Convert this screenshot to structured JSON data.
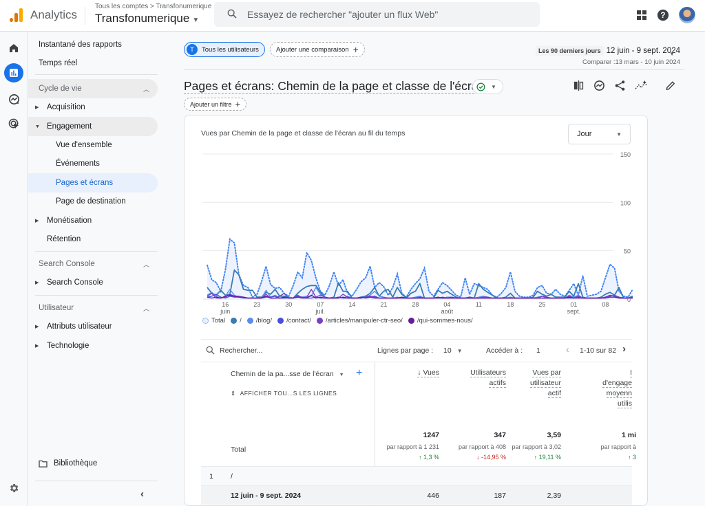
{
  "header": {
    "app_name": "Analytics",
    "breadcrumb": "Tous les comptes > Transfonumerique",
    "property": "Transfonumerique",
    "search_placeholder": "Essayez de rechercher \"ajouter un flux Web\"",
    "icons": [
      "apps-grid-icon",
      "help-icon",
      "avatar"
    ]
  },
  "rail": {
    "items": [
      "home-icon",
      "reports-icon",
      "explore-icon",
      "advertising-icon"
    ],
    "active": "reports-icon",
    "bottom": "settings-icon"
  },
  "sidebar": {
    "top_items": [
      "Instantané des rapports",
      "Temps réel"
    ],
    "sections": [
      {
        "label": "Cycle de vie",
        "items": [
          {
            "label": "Acquisition",
            "expandable": true
          },
          {
            "label": "Engagement",
            "expandable": true,
            "expanded": true,
            "children": [
              "Vue d'ensemble",
              "Événements",
              "Pages et écrans",
              "Page de destination"
            ]
          },
          {
            "label": "Monétisation",
            "expandable": true
          },
          {
            "label": "Rétention",
            "expandable": false
          }
        ]
      },
      {
        "label": "Search Console",
        "items": [
          {
            "label": "Search Console",
            "expandable": true
          }
        ]
      },
      {
        "label": "Utilisateur",
        "items": [
          {
            "label": "Attributs utilisateur",
            "expandable": true
          },
          {
            "label": "Technologie",
            "expandable": true
          }
        ]
      }
    ],
    "selected": "Pages et écrans",
    "library": "Bibliothèque",
    "collapse_icon": "chevron-left-icon"
  },
  "filters": {
    "segment_initial": "T",
    "segment": "Tous les utilisateurs",
    "add_comparison": "Ajouter une comparaison",
    "add_filter": "Ajouter un filtre"
  },
  "date": {
    "preset": "Les 90 derniers jours",
    "range": "12 juin - 9 sept. 2024",
    "compare": "Comparer :13 mars - 10 juin 2024"
  },
  "report": {
    "title": "Pages et écrans: Chemin de la page et classe de l'écran",
    "card_title": "Vues par Chemin de la page et classe de l'écran au fil du temps",
    "granularity": "Jour",
    "toolbar_icons": [
      "compare-icon",
      "insights-icon",
      "share-icon",
      "trend-icon",
      "edit-icon"
    ]
  },
  "chart_data": {
    "type": "line",
    "title": "Vues par Chemin de la page et classe de l'écran au fil du temps",
    "xlabel": "",
    "ylabel": "",
    "ylim": [
      0,
      150
    ],
    "yticks": [
      "0",
      "50",
      "100",
      "150"
    ],
    "xticks": [
      {
        "day": 4,
        "label": "16",
        "sub": "juin"
      },
      {
        "day": 11,
        "label": "23",
        "sub": ""
      },
      {
        "day": 18,
        "label": "30",
        "sub": ""
      },
      {
        "day": 25,
        "label": "07",
        "sub": "juil."
      },
      {
        "day": 32,
        "label": "14",
        "sub": ""
      },
      {
        "day": 39,
        "label": "21",
        "sub": ""
      },
      {
        "day": 46,
        "label": "28",
        "sub": ""
      },
      {
        "day": 53,
        "label": "04",
        "sub": "août"
      },
      {
        "day": 60,
        "label": "11",
        "sub": ""
      },
      {
        "day": 67,
        "label": "18",
        "sub": ""
      },
      {
        "day": 74,
        "label": "25",
        "sub": ""
      },
      {
        "day": 81,
        "label": "01",
        "sub": "sept."
      },
      {
        "day": 88,
        "label": "08",
        "sub": ""
      }
    ],
    "grid": true,
    "legend_position": "bottom-left",
    "start_date": "2024-06-12",
    "days": 90,
    "series": [
      {
        "name": "Total",
        "color": "#4285f4",
        "style": "dotted-area",
        "values": [
          35,
          20,
          17,
          8,
          30,
          62,
          58,
          25,
          14,
          12,
          2,
          5,
          18,
          34,
          15,
          11,
          12,
          6,
          3,
          14,
          28,
          22,
          48,
          40,
          22,
          8,
          4,
          14,
          28,
          14,
          20,
          6,
          3,
          10,
          18,
          22,
          34,
          12,
          17,
          13,
          4,
          12,
          26,
          6,
          2,
          10,
          16,
          21,
          32,
          8,
          3,
          10,
          17,
          14,
          9,
          4,
          2,
          22,
          5,
          16,
          14,
          12,
          10,
          4,
          2,
          6,
          12,
          28,
          8,
          3,
          2,
          2,
          4,
          12,
          14,
          6,
          5,
          10,
          5,
          3,
          9,
          16,
          4,
          24,
          3,
          4,
          5,
          8,
          22,
          36,
          32,
          8,
          3,
          2,
          10
        ]
      },
      {
        "name": "/",
        "color": "#3a7cb1",
        "style": "solid",
        "values": [
          12,
          6,
          4,
          9,
          4,
          5,
          30,
          25,
          10,
          9,
          9,
          2,
          2,
          7,
          5,
          10,
          3,
          3,
          2,
          1,
          6,
          10,
          13,
          14,
          14,
          7,
          2,
          1,
          2,
          17,
          8,
          8,
          1,
          1,
          2,
          3,
          6,
          12,
          3,
          8,
          10,
          2,
          12,
          5,
          1,
          6,
          8,
          16,
          1,
          1,
          1,
          9,
          6,
          8,
          5,
          2,
          1,
          1,
          2,
          1,
          16,
          10,
          7,
          4,
          1,
          1,
          2,
          6,
          1,
          1,
          1,
          1,
          2,
          8,
          5,
          3,
          5,
          2,
          2,
          2,
          8,
          3,
          16,
          2,
          1,
          1,
          1,
          2,
          5,
          7,
          4,
          12,
          1,
          1,
          3
        ]
      },
      {
        "name": "/blog/",
        "color": "#5b8def",
        "style": "solid",
        "values": [
          4,
          7,
          3,
          1,
          3,
          10,
          4,
          2,
          2,
          1,
          1,
          1,
          1,
          9,
          2,
          4,
          1,
          1,
          2,
          1,
          2,
          2,
          3,
          3,
          12,
          5,
          2,
          1,
          1,
          2,
          1,
          3,
          1,
          1,
          1,
          2,
          4,
          8,
          3,
          2,
          1,
          1,
          2,
          1,
          1,
          1,
          2,
          3,
          1,
          1,
          1,
          1,
          1,
          2,
          2,
          1,
          1,
          1,
          1,
          1,
          2,
          3,
          2,
          1,
          1,
          1,
          1,
          2,
          1,
          1,
          1,
          1,
          1,
          2,
          3,
          1,
          1,
          1,
          2,
          1,
          4,
          2,
          4,
          1,
          1,
          1,
          1,
          1,
          2,
          4,
          3,
          2,
          1,
          1,
          2
        ]
      },
      {
        "name": "/contact/",
        "color": "#4a4fd8",
        "style": "solid",
        "values": [
          2,
          3,
          5,
          2,
          1,
          3,
          2,
          2,
          1,
          1,
          1,
          1,
          1,
          2,
          2,
          3,
          1,
          1,
          1,
          1,
          3,
          2,
          1,
          1,
          2,
          1,
          1,
          1,
          1,
          2,
          1,
          1,
          1,
          1,
          1,
          2,
          2,
          3,
          1,
          1,
          1,
          1,
          1,
          1,
          1,
          1,
          1,
          1,
          1,
          1,
          1,
          1,
          1,
          1,
          2,
          1,
          1,
          1,
          1,
          1,
          1,
          1,
          1,
          1,
          1,
          1,
          1,
          1,
          1,
          1,
          1,
          1,
          1,
          1,
          1,
          1,
          1,
          1,
          1,
          1,
          1,
          1,
          2,
          1,
          1,
          1,
          1,
          1,
          2,
          4,
          3,
          1,
          1,
          1,
          2
        ]
      },
      {
        "name": "/articles/manipuler-ctr-seo/",
        "color": "#7b3fc4",
        "style": "solid",
        "values": [
          3,
          6,
          1,
          1,
          2,
          5,
          3,
          3,
          2,
          1,
          1,
          1,
          1,
          5,
          1,
          1,
          3,
          6,
          1,
          1,
          4,
          1,
          2,
          10,
          2,
          4,
          2,
          1,
          1,
          1,
          5,
          2,
          1,
          1,
          1,
          2,
          3,
          2,
          1,
          1,
          1,
          1,
          1,
          1,
          1,
          1,
          1,
          2,
          1,
          1,
          1,
          1,
          2,
          1,
          1,
          1,
          1,
          1,
          2,
          1,
          1,
          2,
          2,
          1,
          1,
          1,
          1,
          1,
          1,
          1,
          1,
          1,
          1,
          1,
          3,
          2,
          1,
          1,
          1,
          1,
          3,
          1,
          3,
          1,
          1,
          1,
          1,
          1,
          2,
          3,
          4,
          2,
          1,
          1,
          1
        ]
      },
      {
        "name": "/qui-sommes-nous/",
        "color": "#6a1b9a",
        "style": "solid",
        "values": [
          2,
          1,
          2,
          1,
          3,
          4,
          3,
          2,
          2,
          1,
          1,
          1,
          1,
          3,
          1,
          1,
          1,
          2,
          1,
          1,
          2,
          1,
          1,
          4,
          1,
          2,
          1,
          1,
          1,
          1,
          2,
          1,
          1,
          1,
          2,
          1,
          2,
          1,
          1,
          1,
          1,
          1,
          1,
          2,
          1,
          1,
          1,
          1,
          1,
          1,
          1,
          2,
          1,
          1,
          1,
          1,
          1,
          1,
          1,
          1,
          1,
          1,
          1,
          1,
          1,
          1,
          1,
          1,
          1,
          1,
          1,
          1,
          1,
          1,
          1,
          1,
          1,
          1,
          1,
          1,
          2,
          1,
          1,
          1,
          1,
          1,
          1,
          1,
          1,
          2,
          2,
          1,
          1,
          1,
          1
        ]
      }
    ]
  },
  "table": {
    "search_placeholder": "Rechercher...",
    "rows_per_page_label": "Lignes par page :",
    "rows_per_page": "10",
    "goto_label": "Accéder à :",
    "goto_value": "1",
    "pagination": "1-10 sur 82",
    "dimension_header": "Chemin de la pa...sse de l'écran",
    "show_all": "AFFICHER TOU...S LES LIGNES",
    "columns": [
      {
        "label_lines": [
          "↓ Vues"
        ]
      },
      {
        "label_lines": [
          "Utilisateurs",
          "actifs"
        ]
      },
      {
        "label_lines": [
          "Vues par",
          "utilisateur",
          "actif"
        ]
      },
      {
        "label_lines": [
          "I",
          "d'engage",
          "moyenn",
          "utilis"
        ]
      }
    ],
    "total": {
      "label": "Total",
      "values": [
        "1247",
        "347",
        "3,59",
        "1 mi"
      ],
      "compare": [
        "par rapport à 1 231",
        "par rapport à 408",
        "par rapport à 3,02",
        "par rapport à"
      ],
      "deltas": [
        {
          "text": "↑ 1,3 %",
          "dir": "up"
        },
        {
          "text": "↓ -14,95 %",
          "dir": "down"
        },
        {
          "text": "↑ 19,11 %",
          "dir": "up"
        },
        {
          "text": "↑ 3",
          "dir": "up"
        }
      ]
    },
    "rows": [
      {
        "index": "1",
        "dimension": "/",
        "period": "12 juin - 9 sept. 2024",
        "values": [
          "446",
          "187",
          "2,39",
          ""
        ]
      }
    ]
  }
}
